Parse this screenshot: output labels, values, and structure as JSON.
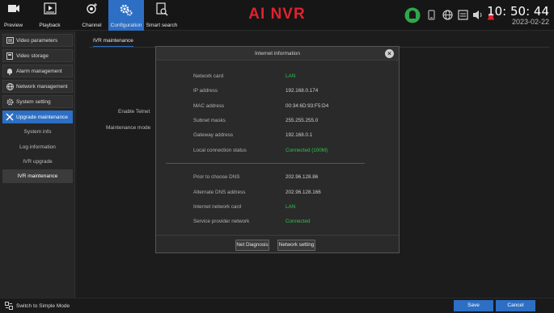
{
  "topbar": {
    "buttons": [
      {
        "label": "Preview",
        "icon": "camera-icon"
      },
      {
        "label": "Playback",
        "icon": "playback-icon"
      },
      {
        "label": "Channel",
        "icon": "channel-icon"
      },
      {
        "label": "Configuration",
        "icon": "gears-icon"
      },
      {
        "label": "Smart search",
        "icon": "search-document-icon"
      }
    ],
    "title": "AI NVR",
    "time": "10: 50: 44",
    "date": "2023-02-22",
    "status_icons": [
      "android-icon",
      "phone-icon",
      "network-globe-icon",
      "display-icon",
      "volume-icon",
      "alarm-icon"
    ],
    "accent_color": "#2d6fc4",
    "title_color": "#e0222e"
  },
  "sidebar": {
    "menus": [
      {
        "label": "Video parameters",
        "icon": "video-parameters-icon"
      },
      {
        "label": "Video storage",
        "icon": "storage-icon"
      },
      {
        "label": "Alarm management",
        "icon": "bell-icon"
      },
      {
        "label": "Network management",
        "icon": "globe-icon"
      },
      {
        "label": "System setting",
        "icon": "gear-icon"
      },
      {
        "label": "Upgrade maintenance",
        "icon": "tools-icon"
      }
    ],
    "submenus": [
      "System info",
      "Log information",
      "IVR upgrade",
      "IVR maintenance"
    ]
  },
  "main": {
    "tab": "IVR maintenance",
    "fields": [
      "Enable Telnet",
      "Maintenance mode"
    ]
  },
  "dialog": {
    "title": "Internet information",
    "rows": [
      {
        "key": "Network card",
        "value": "LAN"
      },
      {
        "key": "IP address",
        "value": "192.168.0.174"
      },
      {
        "key": "MAC address",
        "value": "00:34:6D:93:F5:D4"
      },
      {
        "key": "Subnet masks",
        "value": "255.255.255.0"
      },
      {
        "key": "Gateway address",
        "value": "192.168.0.1"
      },
      {
        "key": "Local connection status",
        "value": "Connected (100M)"
      },
      {
        "key": "Prior to choose DNS",
        "value": "202.96.128.86"
      },
      {
        "key": "Alternate DNS address",
        "value": "202.96.128.166"
      },
      {
        "key": "Internet network card",
        "value": "LAN"
      },
      {
        "key": "Service provider network",
        "value": "Connected"
      }
    ],
    "buttons": [
      "Net Diagnosis",
      "Network setting"
    ]
  },
  "bottombar": {
    "simple_mode": "Switch to Simple Mode",
    "save": "Save",
    "cancel": "Cancel"
  }
}
